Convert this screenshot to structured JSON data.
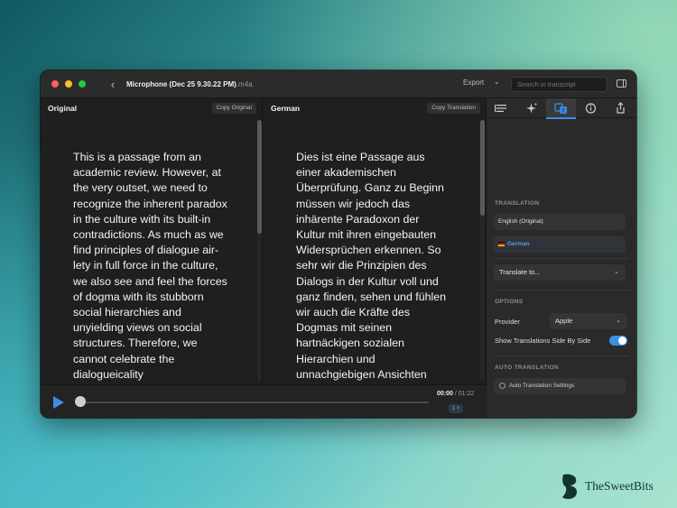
{
  "window": {
    "title": "Microphone (Dec 25 9.30.22 PM)",
    "title_ext": ".m4a",
    "export_label": "Export",
    "search_placeholder": "Search in transcript"
  },
  "original_pane": {
    "title": "Original",
    "copy_label": "Copy Original",
    "text": "This is a passage from an academic review. However, at the very outset, we need to recognize the inherent paradox in the culture with its built-in contradictions. As much as we find principles of dialogue air-lety in full force in the culture, we also see and feel the forces of dogma with its stubborn social hierarchies and unyielding views on social structures. Therefore, we cannot celebrate the dialogueicality"
  },
  "translation_pane": {
    "title": "German",
    "copy_label": "Copy Translation",
    "text": "Dies ist eine Passage aus einer akademischen Überprüfung. Ganz zu Beginn müssen wir jedoch das inhärente Paradoxon der Kultur mit ihren eingebauten Widersprüchen erkennen. So sehr wir die Prinzipien des Dialogs in der Kultur voll und ganz finden, sehen und fühlen wir auch die Kräfte des Dogmas mit seinen hartnäckigen sozialen Hierarchien und unnachgiebigen Ansichten"
  },
  "player": {
    "current_time": "00:00",
    "separator": " / ",
    "duration": "01:22",
    "speed": "1 ×",
    "progress": 0
  },
  "inspector": {
    "tabs": [
      {
        "icon": "transcript-list-icon"
      },
      {
        "icon": "sparkle-icon"
      },
      {
        "icon": "translate-icon",
        "active": true
      },
      {
        "icon": "info-icon"
      },
      {
        "icon": "share-icon"
      }
    ],
    "translation_section": "TRANSLATION",
    "languages": [
      "English (Original)",
      "German"
    ],
    "translate_to": "Translate to...",
    "options_section": "OPTIONS",
    "provider_label": "Provider",
    "provider_value": "Apple",
    "side_by_side_label": "Show Translations Side By Side",
    "side_by_side_on": true,
    "auto_section": "AUTO TRANSLATION",
    "auto_settings": "Auto Translation Settings"
  },
  "watermark": {
    "brand": "TheSweetBits"
  },
  "colors": {
    "accent": "#3b8fe8",
    "window_bg": "#1f1f1f",
    "inspector_bg": "#2a2a2a"
  }
}
